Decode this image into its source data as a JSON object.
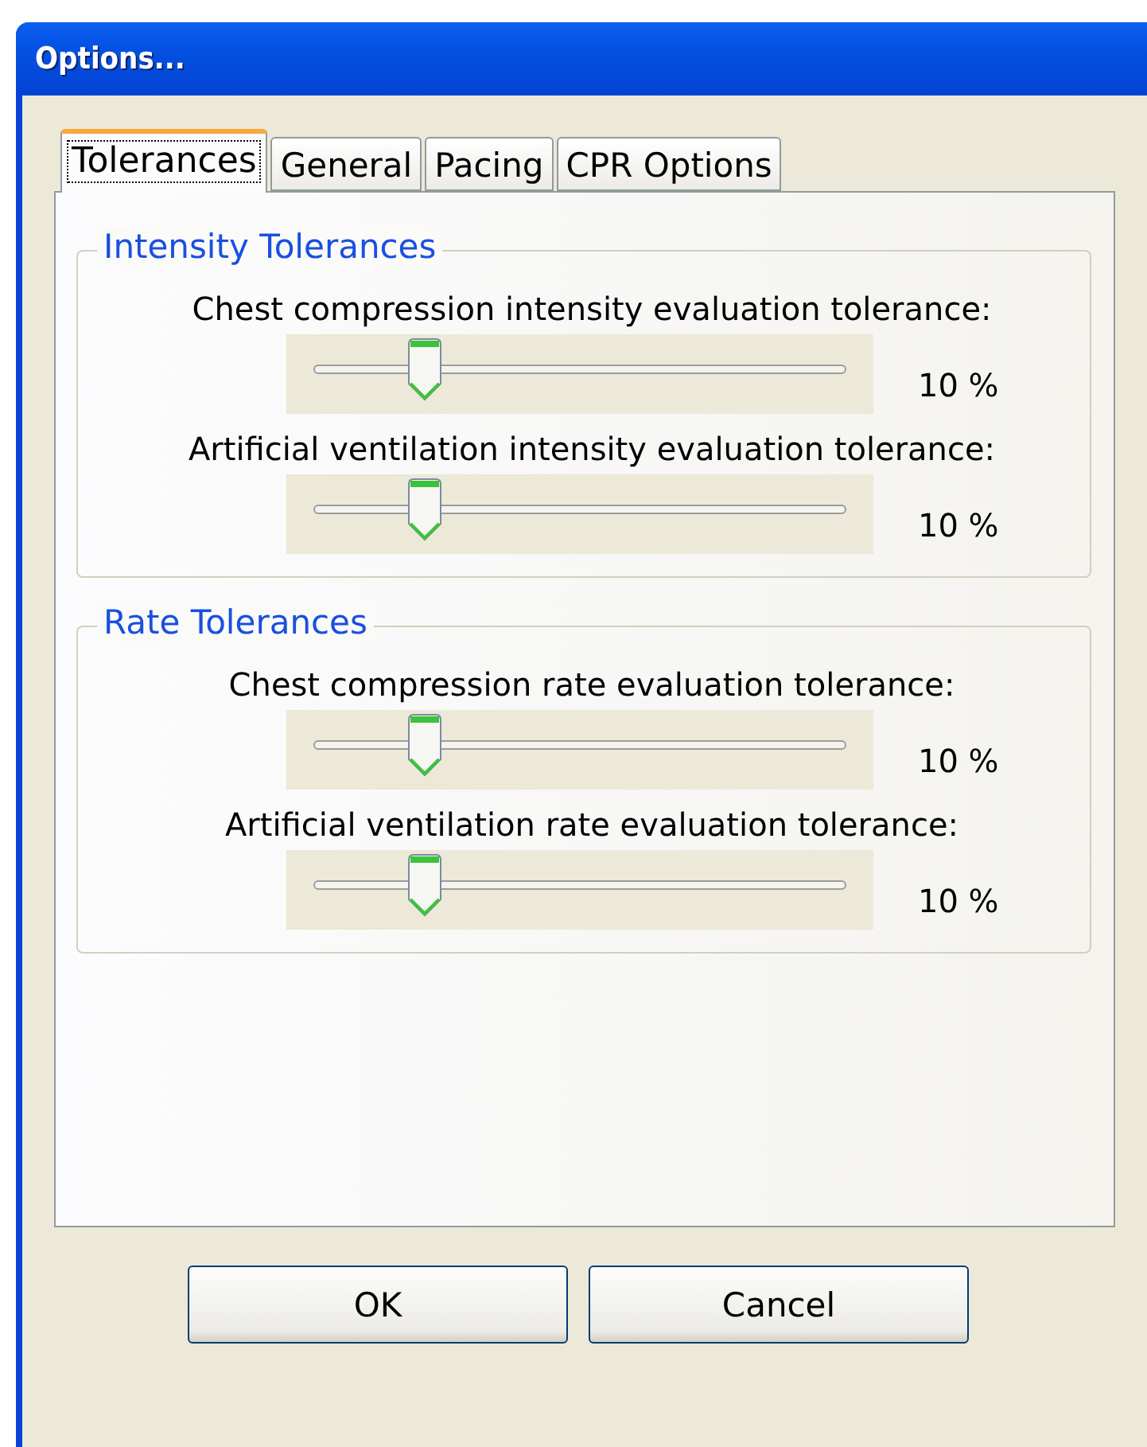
{
  "window": {
    "title": "Options..."
  },
  "tabs": [
    {
      "label": "Tolerances",
      "selected": true
    },
    {
      "label": "General",
      "selected": false
    },
    {
      "label": "Pacing",
      "selected": false
    },
    {
      "label": "CPR Options",
      "selected": false
    }
  ],
  "groups": [
    {
      "title": "Intensity Tolerances",
      "sliders": [
        {
          "label": "Chest compression intensity evaluation tolerance:",
          "level": 0.21,
          "reading": "10 %"
        },
        {
          "label": "Artificial ventilation intensity evaluation tolerance:",
          "level": 0.21,
          "reading": "10 %"
        }
      ]
    },
    {
      "title": "Rate Tolerances",
      "sliders": [
        {
          "label": "Chest compression rate evaluation tolerance:",
          "level": 0.21,
          "reading": "10 %"
        },
        {
          "label": "Artificial ventilation rate evaluation tolerance:",
          "level": 0.21,
          "reading": "10 %"
        }
      ]
    }
  ],
  "buttons": [
    "OK",
    "Cancel"
  ]
}
